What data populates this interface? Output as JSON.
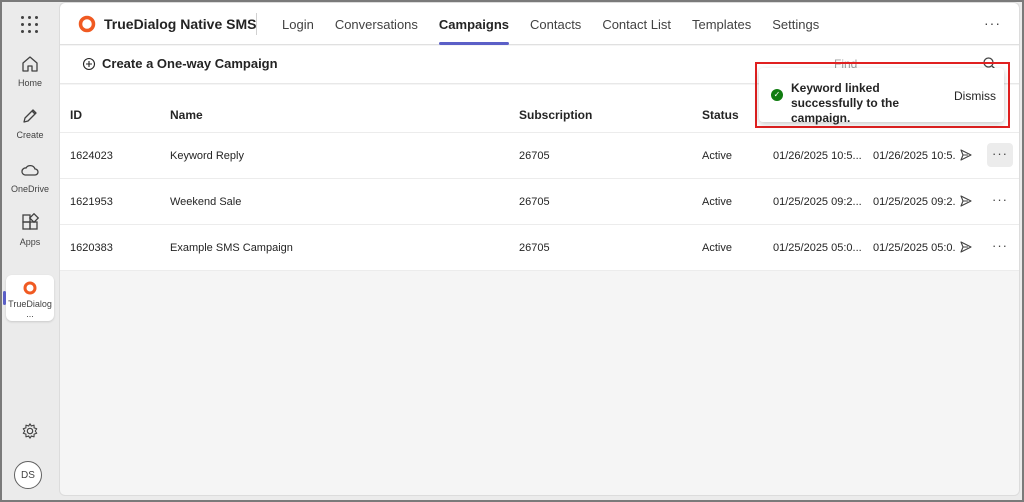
{
  "rail": {
    "items": [
      {
        "label": "Home",
        "icon": "home-icon"
      },
      {
        "label": "Create",
        "icon": "pen-icon"
      },
      {
        "label": "OneDrive",
        "icon": "cloud-icon"
      },
      {
        "label": "Apps",
        "icon": "apps-icon"
      },
      {
        "label": "TrueDialog ...",
        "icon": "truedialog-logo-icon"
      }
    ],
    "avatar": "DS"
  },
  "app": {
    "title": "TrueDialog Native SMS",
    "brand_color": "#f05a22",
    "tabs": [
      "Login",
      "Conversations",
      "Campaigns",
      "Contacts",
      "Contact List",
      "Templates",
      "Settings"
    ],
    "active_tab": "Campaigns",
    "more": "···"
  },
  "toolbar": {
    "create_label": "Create a One-way Campaign",
    "find_placeholder": "Find"
  },
  "table": {
    "columns": [
      "ID",
      "Name",
      "Subscription",
      "Status"
    ],
    "rows": [
      {
        "id": "1624023",
        "name": "Keyword Reply",
        "subscription": "26705",
        "status": "Active",
        "date1": "01/26/2025 10:5...",
        "date2": "01/26/2025 10:5..."
      },
      {
        "id": "1621953",
        "name": "Weekend Sale",
        "subscription": "26705",
        "status": "Active",
        "date1": "01/25/2025 09:2...",
        "date2": "01/25/2025 09:2..."
      },
      {
        "id": "1620383",
        "name": "Example SMS Campaign",
        "subscription": "26705",
        "status": "Active",
        "date1": "01/25/2025 05:0...",
        "date2": "01/25/2025 05:0..."
      }
    ],
    "row_more": "···"
  },
  "toast": {
    "message": "Keyword linked successfully to the campaign.",
    "dismiss": "Dismiss",
    "status_color": "#107c10",
    "highlight_color": "#e02020"
  }
}
